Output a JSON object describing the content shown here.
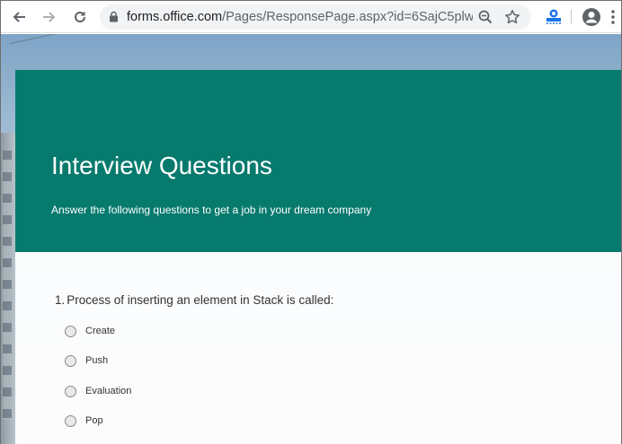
{
  "browser": {
    "url_domain": "forms.office.com",
    "url_path": "/Pages/ResponsePage.aspx?id=6SajC5plw..."
  },
  "form": {
    "title": "Interview Questions",
    "subtitle": "Answer the following questions to get a job in your dream company",
    "header_color": "#077a6e"
  },
  "question": {
    "number": "1.",
    "text": "Process of inserting an element in Stack is called:",
    "options": [
      "Create",
      "Push",
      "Evaluation",
      "Pop"
    ]
  }
}
